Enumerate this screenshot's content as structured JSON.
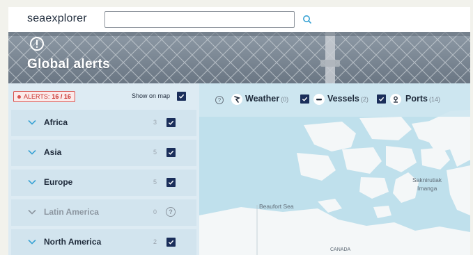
{
  "header": {
    "logo": "seaexplorer",
    "search": {
      "value": "",
      "placeholder": ""
    }
  },
  "hero": {
    "title": "Global alerts"
  },
  "alerts_panel": {
    "badge_prefix": "ALERTS:",
    "badge_count": "16 / 16",
    "show_on_map_label": "Show on map",
    "show_on_map_checked": true,
    "regions": [
      {
        "name": "Africa",
        "count": "3",
        "checked": true,
        "enabled": true
      },
      {
        "name": "Asia",
        "count": "5",
        "checked": true,
        "enabled": true
      },
      {
        "name": "Europe",
        "count": "5",
        "checked": true,
        "enabled": true
      },
      {
        "name": "Latin America",
        "count": "0",
        "checked": false,
        "enabled": false
      },
      {
        "name": "North America",
        "count": "2",
        "checked": true,
        "enabled": true
      }
    ]
  },
  "map": {
    "layers": [
      {
        "name": "Weather",
        "count": "(0)",
        "icon": "weather-icon"
      },
      {
        "name": "Vessels",
        "count": "(2)",
        "icon": "vessel-icon",
        "checked": true
      },
      {
        "name": "Ports",
        "count": "(14)",
        "icon": "port-icon",
        "checked": true
      }
    ],
    "labels": {
      "beaufort": "Beaufort Sea",
      "sakirmiut_1": "Saknirutiak",
      "sakirmiut_2": "Imanga",
      "canada": "CANADA"
    }
  },
  "colors": {
    "checkbox": "#1a2e5a",
    "panel": "#ddebf3",
    "sea": "#bfe0ec",
    "land": "#f4f7f8",
    "alert": "#d9534f"
  }
}
